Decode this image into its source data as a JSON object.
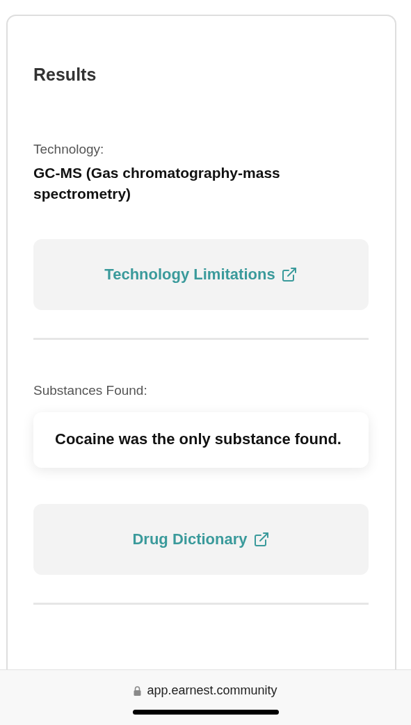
{
  "results": {
    "title": "Results",
    "technology_label": "Technology:",
    "technology_value": "GC-MS (Gas chromatography-mass spectrometry)",
    "technology_link": "Technology Limitations",
    "substances_label": "Substances Found:",
    "substances_value": "Cocaine was the only substance found.",
    "dictionary_link": "Drug Dictionary"
  },
  "browser_bar": {
    "url": "app.earnest.community"
  }
}
